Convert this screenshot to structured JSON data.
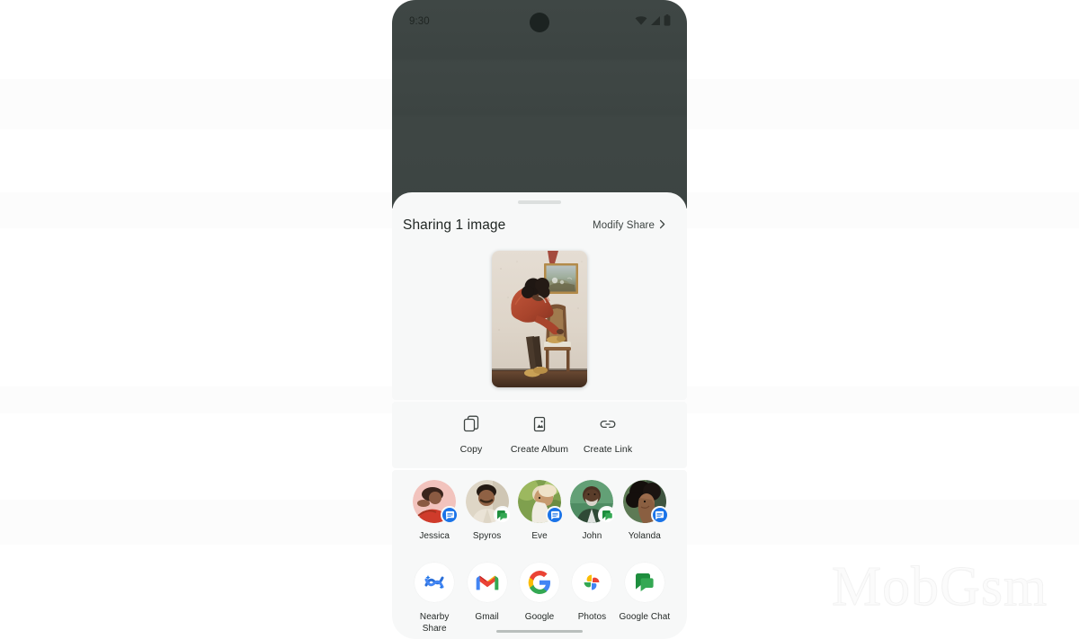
{
  "statusbar": {
    "time": "9:30",
    "icons": [
      "wifi-icon",
      "cellular-signal-icon",
      "battery-icon"
    ]
  },
  "sheet": {
    "drag_handle": "drag-handle",
    "title": "Sharing 1 image",
    "modify_share_label": "Modify Share",
    "modify_share_icon": "chevron-right-icon",
    "preview": {
      "alt": "Person in rust-colored coat leaning beside a wooden chair in front of a framed landscape painting on a textured cream wall",
      "count": 1
    },
    "actions": [
      {
        "label": "Copy",
        "icon": "copy-icon"
      },
      {
        "label": "Create Album",
        "icon": "create-album-icon"
      },
      {
        "label": "Create Link",
        "icon": "link-icon"
      }
    ],
    "contacts": [
      {
        "name": "Jessica",
        "badge": "google-messages-icon",
        "badge_type": "messages"
      },
      {
        "name": "Spyros",
        "badge": "google-chat-icon",
        "badge_type": "chat"
      },
      {
        "name": "Eve",
        "badge": "google-messages-icon",
        "badge_type": "messages"
      },
      {
        "name": "John",
        "badge": "google-chat-icon",
        "badge_type": "chat"
      },
      {
        "name": "Yolanda",
        "badge": "google-messages-icon",
        "badge_type": "messages"
      }
    ],
    "apps": [
      {
        "label": "Nearby Share",
        "icon": "nearby-share-icon"
      },
      {
        "label": "Gmail",
        "icon": "gmail-icon"
      },
      {
        "label": "Google",
        "icon": "google-icon"
      },
      {
        "label": "Photos",
        "icon": "google-photos-icon"
      },
      {
        "label": "Google Chat",
        "icon": "google-chat-icon"
      }
    ]
  },
  "watermark": {
    "text": "MobGsm"
  },
  "colors": {
    "sheet_surface": "#f7f8f8",
    "scrim": "#3d4543",
    "accent_blue": "#1a73e8",
    "accent_green": "#1e8e3e",
    "text_primary": "#1f2522"
  }
}
